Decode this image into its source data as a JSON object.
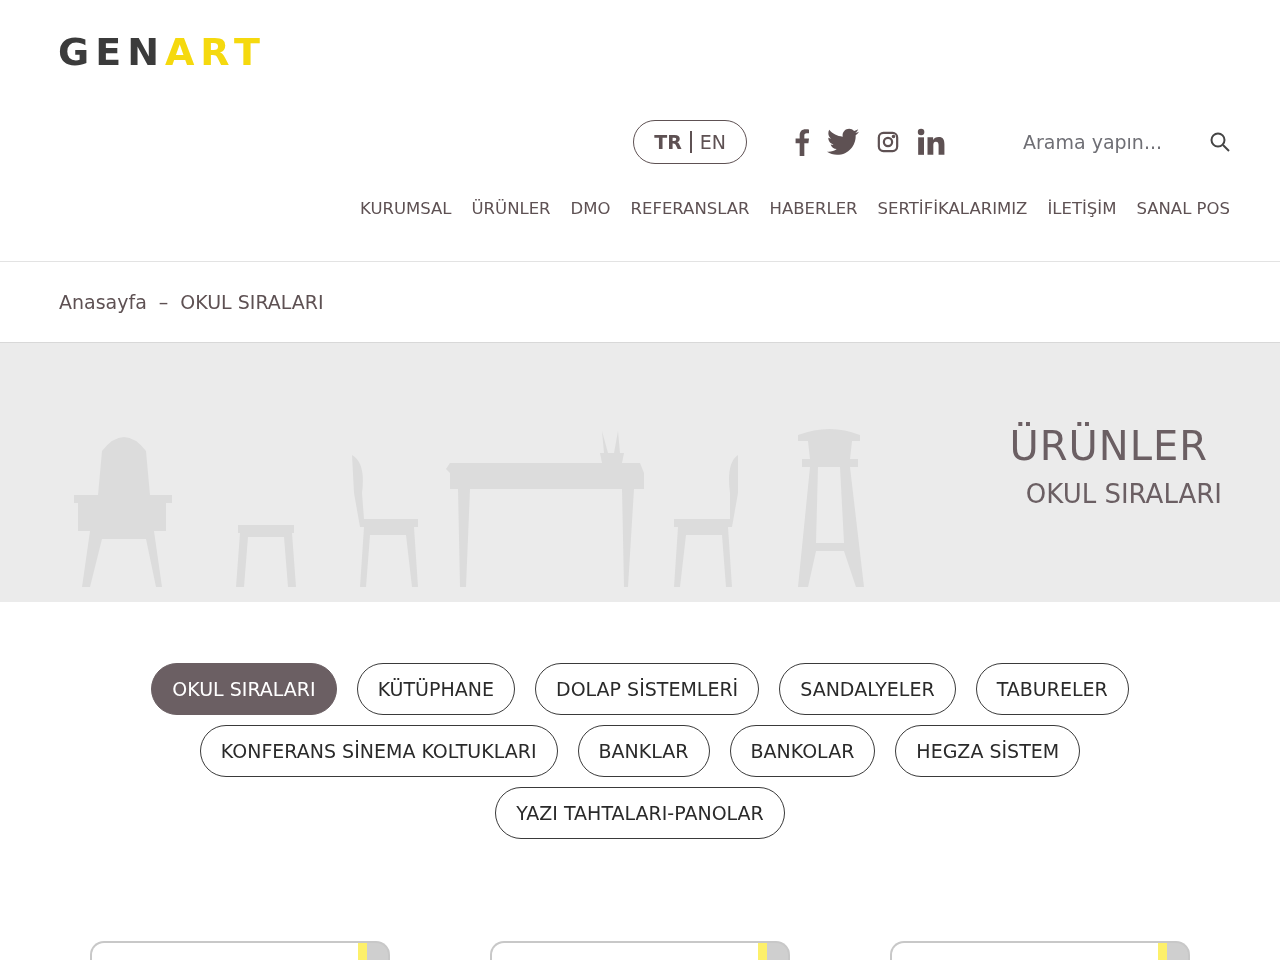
{
  "logo": {
    "dark": "GEN",
    "accent": "ART"
  },
  "languages": [
    {
      "label": "TR",
      "selected": true
    },
    {
      "label": "EN",
      "selected": false
    }
  ],
  "search": {
    "placeholder": "Arama yapın..."
  },
  "nav": [
    "KURUMSAL",
    "ÜRÜNLER",
    "DMO",
    "REFERANSLAR",
    "HABERLER",
    "SERTİFİKALARIMIZ",
    "İLETİŞİM",
    "SANAL POS"
  ],
  "breadcrumb": [
    "Anasayfa",
    "OKUL SIRALARI"
  ],
  "breadcrumb_separator": "–",
  "banner": {
    "title": "ÜRÜNLER",
    "subtitle": "OKUL SIRALARI"
  },
  "categories": [
    {
      "label": "OKUL SIRALARI",
      "selected": true
    },
    {
      "label": "KÜTÜPHANE",
      "selected": false
    },
    {
      "label": "DOLAP SİSTEMLERİ",
      "selected": false
    },
    {
      "label": "SANDALYELER",
      "selected": false
    },
    {
      "label": "TABURELER",
      "selected": false
    },
    {
      "label": "KONFERANS SİNEMA KOLTUKLARI",
      "selected": false
    },
    {
      "label": "BANKLAR",
      "selected": false
    },
    {
      "label": "BANKOLAR",
      "selected": false
    },
    {
      "label": "HEGZA SİSTEM",
      "selected": false
    },
    {
      "label": "YAZI TAHTALARI-PANOLAR",
      "selected": false
    }
  ]
}
